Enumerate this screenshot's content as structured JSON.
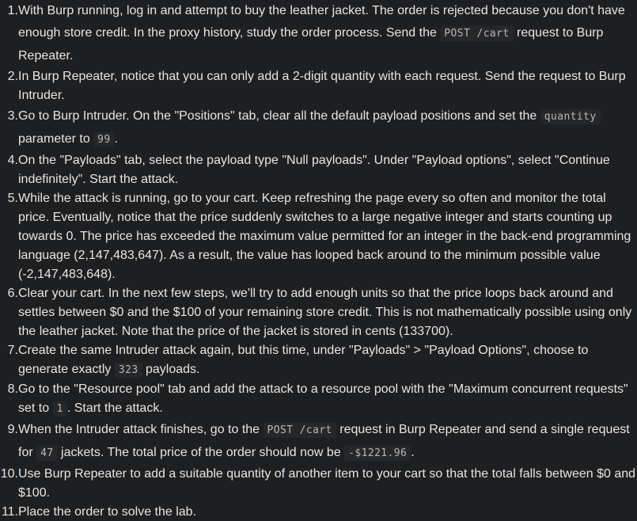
{
  "steps": [
    {
      "number": "1.",
      "parts": [
        {
          "t": "text",
          "v": "With Burp running, log in and attempt to buy the leather jacket. The order is rejected because you don't have enough store credit. In the proxy history, study the order process. Send the "
        },
        {
          "t": "code",
          "v": "POST /cart"
        },
        {
          "t": "text",
          "v": " request to Burp Repeater."
        }
      ]
    },
    {
      "number": "2.",
      "parts": [
        {
          "t": "text",
          "v": "In Burp Repeater, notice that you can only add a 2-digit quantity with each request. Send the request to Burp Intruder."
        }
      ]
    },
    {
      "number": "3.",
      "parts": [
        {
          "t": "text",
          "v": "Go to Burp Intruder. On the \"Positions\" tab, clear all the default payload positions and set the "
        },
        {
          "t": "code",
          "v": "quantity"
        },
        {
          "t": "text",
          "v": " parameter to "
        },
        {
          "t": "code",
          "v": "99"
        },
        {
          "t": "text",
          "v": "."
        }
      ]
    },
    {
      "number": "4.",
      "parts": [
        {
          "t": "text",
          "v": "On the \"Payloads\" tab, select the payload type \"Null payloads\". Under \"Payload options\", select \"Continue indefinitely\". Start the attack."
        }
      ]
    },
    {
      "number": "5.",
      "parts": [
        {
          "t": "text",
          "v": "While the attack is running, go to your cart. Keep refreshing the page every so often and monitor the total price. Eventually, notice that the price suddenly switches to a large negative integer and starts counting up towards 0. The price has exceeded the maximum value permitted for an integer in the back-end programming language (2,147,483,647). As a result, the value has looped back around to the minimum possible value (-2,147,483,648)."
        }
      ]
    },
    {
      "number": "6.",
      "parts": [
        {
          "t": "text",
          "v": "Clear your cart. In the next few steps, we'll try to add enough units so that the price loops back around and settles between $0 and the $100 of your remaining store credit. This is not mathematically possible using only the leather jacket. Note that the price of the jacket is stored in cents (133700)."
        }
      ]
    },
    {
      "number": "7.",
      "parts": [
        {
          "t": "text",
          "v": "Create the same Intruder attack again, but this time, under \"Payloads\" > \"Payload Options\", choose to generate exactly "
        },
        {
          "t": "code",
          "v": "323"
        },
        {
          "t": "text",
          "v": " payloads."
        }
      ]
    },
    {
      "number": "8.",
      "parts": [
        {
          "t": "text",
          "v": "Go to the \"Resource pool\" tab and add the attack to a resource pool with the \"Maximum concurrent requests\" set to "
        },
        {
          "t": "code",
          "v": "1"
        },
        {
          "t": "text",
          "v": ". Start the attack."
        }
      ]
    },
    {
      "number": "9.",
      "parts": [
        {
          "t": "text",
          "v": "When the Intruder attack finishes, go to the "
        },
        {
          "t": "code",
          "v": "POST /cart"
        },
        {
          "t": "text",
          "v": " request in Burp Repeater and send a single request for "
        },
        {
          "t": "code",
          "v": "47"
        },
        {
          "t": "text",
          "v": " jackets. The total price of the order should now be "
        },
        {
          "t": "code",
          "v": "-$1221.96"
        },
        {
          "t": "text",
          "v": "."
        }
      ]
    },
    {
      "number": "10.",
      "parts": [
        {
          "t": "text",
          "v": "Use Burp Repeater to add a suitable quantity of another item to your cart so that the total falls between $0 and $100."
        }
      ]
    },
    {
      "number": "11.",
      "parts": [
        {
          "t": "text",
          "v": "Place the order to solve the lab."
        }
      ]
    }
  ]
}
